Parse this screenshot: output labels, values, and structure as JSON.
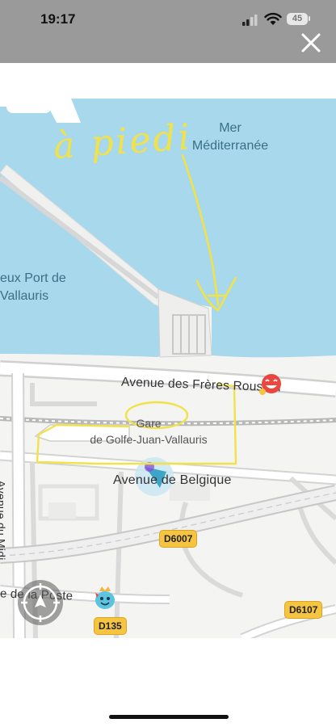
{
  "status_bar": {
    "time": "19:17",
    "battery": "45"
  },
  "map": {
    "water_labels": {
      "sea_line1": "Mer",
      "sea_line2": "Méditerranée",
      "port_line1": "eux Port de",
      "port_line2": "Vallauris"
    },
    "streets": {
      "avenue_freres": "Avenue des Frères Roustan",
      "avenue_belgique": "Avenue de Belgique",
      "avenue_midi": "Avenue du Midi",
      "rue_poste": "e de la Poste"
    },
    "poi": {
      "gare_line1": "Gare",
      "gare_line2": "de Golfe-Juan-Vallauris"
    },
    "road_shields": {
      "d6007": "D6007",
      "d6107": "D6107",
      "d135": "D135"
    },
    "annotation": {
      "handwritten_text": "à piedi"
    },
    "colors": {
      "water": "#a7d8ec",
      "land": "#f4f4f2",
      "road": "#ffffff",
      "railway": "#c9c9c9",
      "annotation": "#f2e24a",
      "shield": "#f5c542",
      "location_arrow": "#3da6c8"
    }
  }
}
